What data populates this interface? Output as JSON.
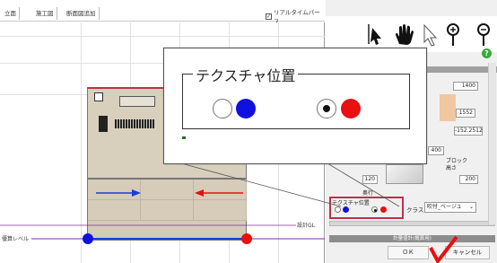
{
  "tabs": [
    "立面",
    "施工図",
    "断面図追加"
  ],
  "realtime_perspective": {
    "label": "リアルタイムパース",
    "checked": true
  },
  "canvas": {
    "level_label": "優算レベル",
    "design_gl_label": "設計GL"
  },
  "callout": {
    "title": "テクスチャ位置",
    "left_option_selected": false,
    "right_option_selected": true
  },
  "panel": {
    "fields": {
      "width_top": "1400",
      "mid": "1552",
      "offset": "-152.2512",
      "height1": "400",
      "depth": "120",
      "block_height": "200"
    },
    "block_height_label": "ブロック\n高さ",
    "depth_label": "奥行",
    "texture_label": "テクスチャ位置",
    "class_label": "クラス",
    "class_value": "吹付_ベージュ",
    "estimate_header": "計量値計(概算用)",
    "ok_label": "ＯＫ",
    "cancel_label": "キャンセル"
  },
  "colors": {
    "blue": "#1010e0",
    "red": "#e81010",
    "accent": "#c0304a"
  }
}
